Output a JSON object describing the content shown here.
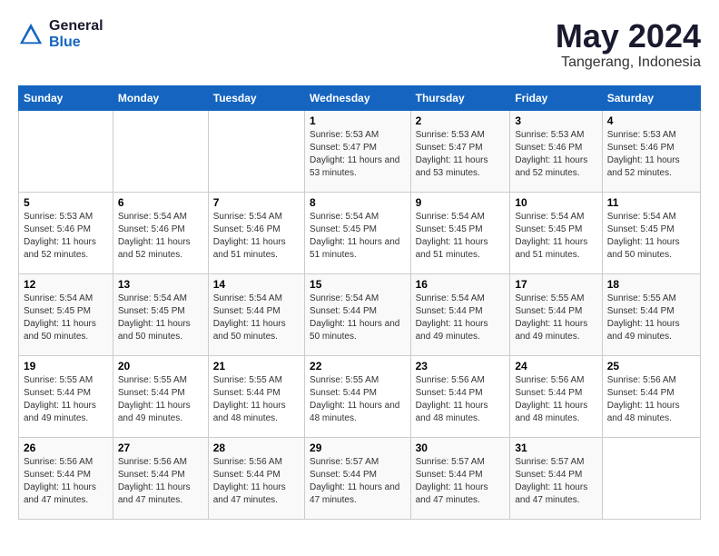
{
  "logo": {
    "general": "General",
    "blue": "Blue"
  },
  "title": {
    "month_year": "May 2024",
    "location": "Tangerang, Indonesia"
  },
  "days_of_week": [
    "Sunday",
    "Monday",
    "Tuesday",
    "Wednesday",
    "Thursday",
    "Friday",
    "Saturday"
  ],
  "weeks": [
    {
      "cells": [
        {
          "day": "",
          "content": ""
        },
        {
          "day": "",
          "content": ""
        },
        {
          "day": "",
          "content": ""
        },
        {
          "day": "1",
          "content": "Sunrise: 5:53 AM\nSunset: 5:47 PM\nDaylight: 11 hours and 53 minutes."
        },
        {
          "day": "2",
          "content": "Sunrise: 5:53 AM\nSunset: 5:47 PM\nDaylight: 11 hours and 53 minutes."
        },
        {
          "day": "3",
          "content": "Sunrise: 5:53 AM\nSunset: 5:46 PM\nDaylight: 11 hours and 52 minutes."
        },
        {
          "day": "4",
          "content": "Sunrise: 5:53 AM\nSunset: 5:46 PM\nDaylight: 11 hours and 52 minutes."
        }
      ]
    },
    {
      "cells": [
        {
          "day": "5",
          "content": "Sunrise: 5:53 AM\nSunset: 5:46 PM\nDaylight: 11 hours and 52 minutes."
        },
        {
          "day": "6",
          "content": "Sunrise: 5:54 AM\nSunset: 5:46 PM\nDaylight: 11 hours and 52 minutes."
        },
        {
          "day": "7",
          "content": "Sunrise: 5:54 AM\nSunset: 5:46 PM\nDaylight: 11 hours and 51 minutes."
        },
        {
          "day": "8",
          "content": "Sunrise: 5:54 AM\nSunset: 5:45 PM\nDaylight: 11 hours and 51 minutes."
        },
        {
          "day": "9",
          "content": "Sunrise: 5:54 AM\nSunset: 5:45 PM\nDaylight: 11 hours and 51 minutes."
        },
        {
          "day": "10",
          "content": "Sunrise: 5:54 AM\nSunset: 5:45 PM\nDaylight: 11 hours and 51 minutes."
        },
        {
          "day": "11",
          "content": "Sunrise: 5:54 AM\nSunset: 5:45 PM\nDaylight: 11 hours and 50 minutes."
        }
      ]
    },
    {
      "cells": [
        {
          "day": "12",
          "content": "Sunrise: 5:54 AM\nSunset: 5:45 PM\nDaylight: 11 hours and 50 minutes."
        },
        {
          "day": "13",
          "content": "Sunrise: 5:54 AM\nSunset: 5:45 PM\nDaylight: 11 hours and 50 minutes."
        },
        {
          "day": "14",
          "content": "Sunrise: 5:54 AM\nSunset: 5:44 PM\nDaylight: 11 hours and 50 minutes."
        },
        {
          "day": "15",
          "content": "Sunrise: 5:54 AM\nSunset: 5:44 PM\nDaylight: 11 hours and 50 minutes."
        },
        {
          "day": "16",
          "content": "Sunrise: 5:54 AM\nSunset: 5:44 PM\nDaylight: 11 hours and 49 minutes."
        },
        {
          "day": "17",
          "content": "Sunrise: 5:55 AM\nSunset: 5:44 PM\nDaylight: 11 hours and 49 minutes."
        },
        {
          "day": "18",
          "content": "Sunrise: 5:55 AM\nSunset: 5:44 PM\nDaylight: 11 hours and 49 minutes."
        }
      ]
    },
    {
      "cells": [
        {
          "day": "19",
          "content": "Sunrise: 5:55 AM\nSunset: 5:44 PM\nDaylight: 11 hours and 49 minutes."
        },
        {
          "day": "20",
          "content": "Sunrise: 5:55 AM\nSunset: 5:44 PM\nDaylight: 11 hours and 49 minutes."
        },
        {
          "day": "21",
          "content": "Sunrise: 5:55 AM\nSunset: 5:44 PM\nDaylight: 11 hours and 48 minutes."
        },
        {
          "day": "22",
          "content": "Sunrise: 5:55 AM\nSunset: 5:44 PM\nDaylight: 11 hours and 48 minutes."
        },
        {
          "day": "23",
          "content": "Sunrise: 5:56 AM\nSunset: 5:44 PM\nDaylight: 11 hours and 48 minutes."
        },
        {
          "day": "24",
          "content": "Sunrise: 5:56 AM\nSunset: 5:44 PM\nDaylight: 11 hours and 48 minutes."
        },
        {
          "day": "25",
          "content": "Sunrise: 5:56 AM\nSunset: 5:44 PM\nDaylight: 11 hours and 48 minutes."
        }
      ]
    },
    {
      "cells": [
        {
          "day": "26",
          "content": "Sunrise: 5:56 AM\nSunset: 5:44 PM\nDaylight: 11 hours and 47 minutes."
        },
        {
          "day": "27",
          "content": "Sunrise: 5:56 AM\nSunset: 5:44 PM\nDaylight: 11 hours and 47 minutes."
        },
        {
          "day": "28",
          "content": "Sunrise: 5:56 AM\nSunset: 5:44 PM\nDaylight: 11 hours and 47 minutes."
        },
        {
          "day": "29",
          "content": "Sunrise: 5:57 AM\nSunset: 5:44 PM\nDaylight: 11 hours and 47 minutes."
        },
        {
          "day": "30",
          "content": "Sunrise: 5:57 AM\nSunset: 5:44 PM\nDaylight: 11 hours and 47 minutes."
        },
        {
          "day": "31",
          "content": "Sunrise: 5:57 AM\nSunset: 5:44 PM\nDaylight: 11 hours and 47 minutes."
        },
        {
          "day": "",
          "content": ""
        }
      ]
    }
  ]
}
